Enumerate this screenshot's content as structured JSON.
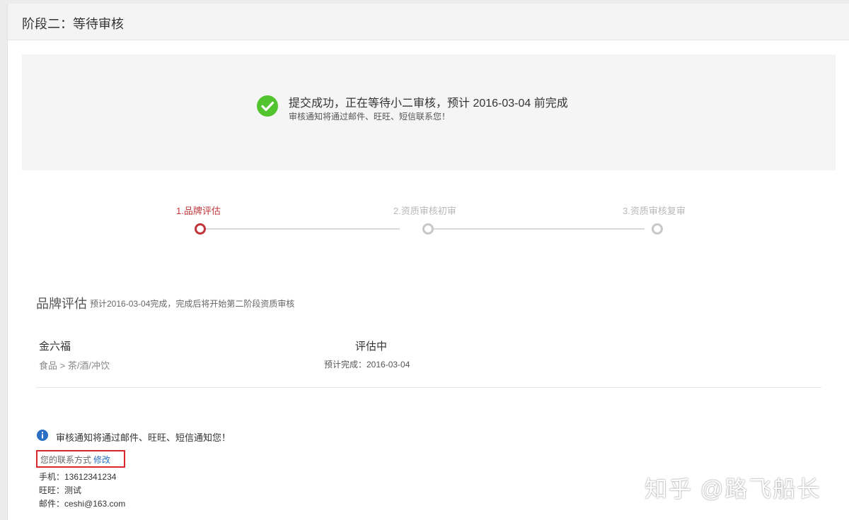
{
  "header": {
    "title": "阶段二：等待审核"
  },
  "notice": {
    "main": "提交成功，正在等待小二审核，预计 2016-03-04 前完成",
    "sub": "审核通知将通过邮件、旺旺、短信联系您！"
  },
  "steps": [
    {
      "label": "1.品牌评估",
      "state": "active"
    },
    {
      "label": "2.资质审核初审",
      "state": "pending"
    },
    {
      "label": "3.资质审核复审",
      "state": "pending"
    }
  ],
  "section": {
    "title": "品牌评估",
    "desc": "预计2016-03-04完成，完成后将开始第二阶段资质审核"
  },
  "brand": {
    "name": "金六福",
    "category": "食品 > 茶/酒/冲饮",
    "status": "评估中",
    "expected": "预计完成：2016-03-04"
  },
  "info": {
    "text": "审核通知将通过邮件、旺旺、短信通知您！"
  },
  "contact": {
    "label": "您的联系方式",
    "edit_label": "修改",
    "phone": "手机：13612341234",
    "wangwang": "旺旺：测试",
    "email": "邮件：ceshi@163.com"
  },
  "watermark": "知乎 @路飞船长",
  "colors": {
    "accent_red": "#c0343b",
    "success_green": "#52c42f",
    "info_blue": "#2a6fc2"
  }
}
